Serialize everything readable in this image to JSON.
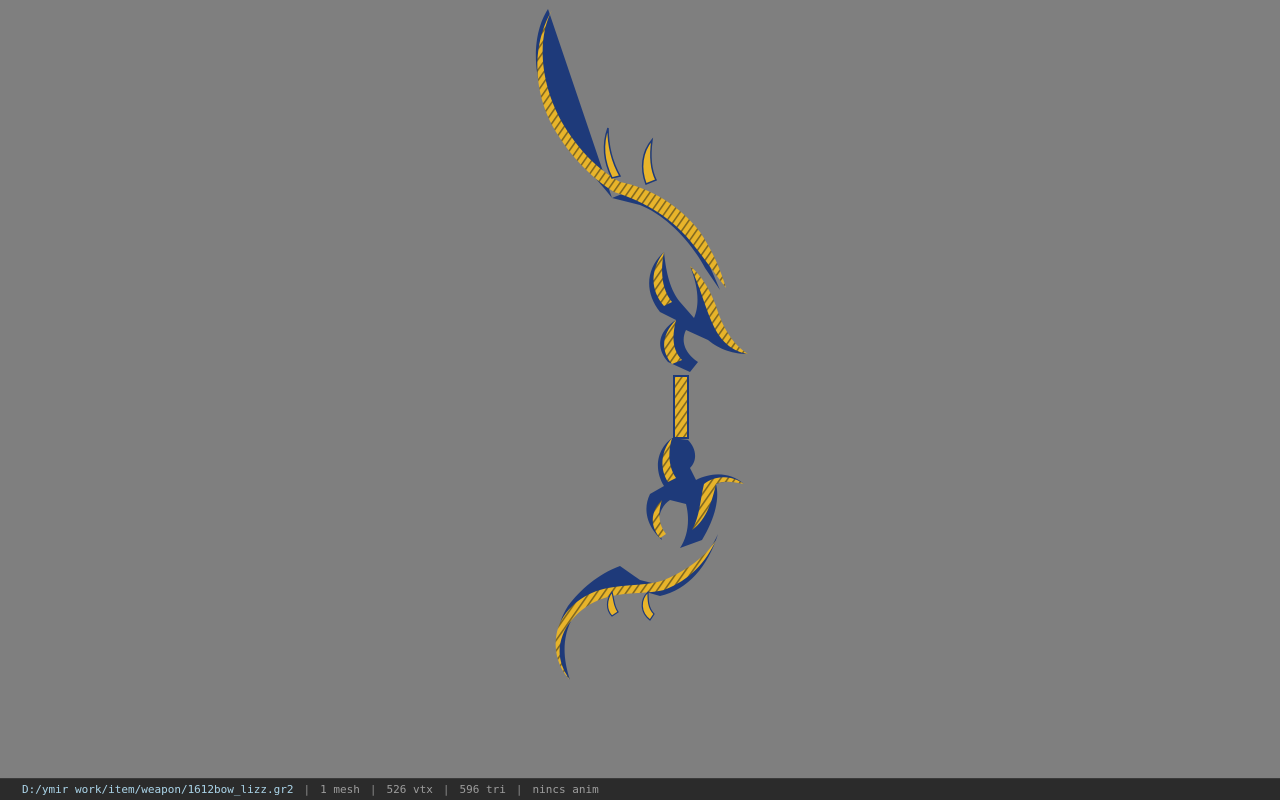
{
  "viewer": {
    "background_color": "#7f7f7f",
    "model": {
      "icon": "bow-model",
      "primary_color": "#e8b42a",
      "secondary_color": "#1e3a7a",
      "shadow_color": "#1a1a1a"
    }
  },
  "status_bar": {
    "file_path": "D:/ymir work/item/weapon/1612bow_lizz.gr2",
    "separator": "|",
    "mesh_count": "1 mesh",
    "vertex_count": "526 vtx",
    "triangle_count": "596 tri",
    "anim_status": "nincs anim"
  }
}
